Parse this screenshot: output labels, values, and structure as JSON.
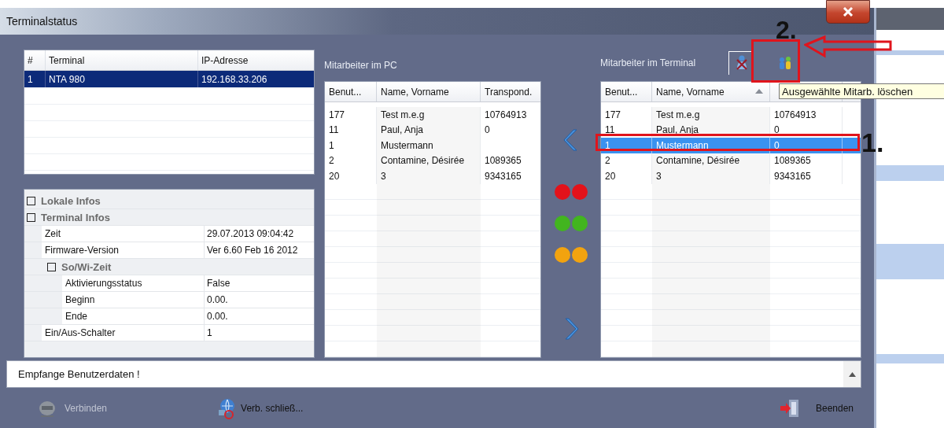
{
  "window": {
    "title": "Terminalstatus"
  },
  "terminals": {
    "columns": [
      "#",
      "Terminal",
      "IP-Adresse"
    ],
    "rows": [
      {
        "cells": [
          "1",
          "NTA 980",
          "192.168.33.206"
        ],
        "selected": true
      }
    ]
  },
  "properties": [
    {
      "kind": "category",
      "label": "Lokale Infos"
    },
    {
      "kind": "category",
      "label": "Terminal Infos",
      "children": [
        {
          "kind": "property",
          "label": "Zeit",
          "value": "29.07.2013 09:04:42"
        },
        {
          "kind": "property",
          "label": "Firmware-Version",
          "value": "Ver 6.60 Feb 16 2012"
        },
        {
          "kind": "category",
          "label": "So/Wi-Zeit",
          "children": [
            {
              "kind": "property",
              "label": "Aktivierungsstatus",
              "value": "False"
            },
            {
              "kind": "property",
              "label": "Beginn",
              "value": " 0.00."
            },
            {
              "kind": "property",
              "label": "Ende",
              "value": " 0.00."
            }
          ]
        },
        {
          "kind": "property",
          "label": "Ein/Aus-Schalter",
          "value": "1"
        }
      ]
    }
  ],
  "pc_employees": {
    "title": "Mitarbeiter im PC",
    "columns": [
      {
        "label": "Benut...",
        "sorted": false
      },
      {
        "label": "Name, Vorname",
        "sorted": false
      },
      {
        "label": "Transpond.",
        "sorted": false
      }
    ],
    "rows": [
      {
        "cells": [
          "177",
          "Test m.e.g",
          "10764913"
        ],
        "selected": false
      },
      {
        "cells": [
          "11",
          "Paul, Anja",
          "0"
        ],
        "selected": false
      },
      {
        "cells": [
          "1",
          "Mustermann"
        ],
        "selected": false
      },
      {
        "cells": [
          "2",
          "Contamine, Désirée",
          "1089365"
        ],
        "selected": false
      },
      {
        "cells": [
          "20",
          "3",
          "9343165"
        ],
        "selected": false
      }
    ]
  },
  "lamps": [
    {
      "color": "#e3121a"
    },
    {
      "color": "#42b51f"
    },
    {
      "color": "#f2a30f"
    }
  ],
  "terminal_employees": {
    "title": "Mitarbeiter im Terminal",
    "columns": [
      {
        "label": "Benut...",
        "sorted": false
      },
      {
        "label": "Name, Vorname",
        "sorted": true
      }
    ],
    "rows": [
      {
        "cells": [
          "177",
          "Test m.e.g",
          "10764913"
        ],
        "selected": false
      },
      {
        "cells": [
          "11",
          "Paul, Anja",
          "0"
        ],
        "selected": false
      },
      {
        "cells": [
          "1",
          "Mustermann",
          "0"
        ],
        "selected": true
      },
      {
        "cells": [
          "2",
          "Contamine, Désirée",
          "1089365"
        ],
        "selected": false
      },
      {
        "cells": [
          "20",
          "3",
          "9343165"
        ],
        "selected": false
      }
    ]
  },
  "tooltip": "Ausgewählte Mitarb. löschen",
  "status": {
    "message": "Empfange Benutzerdaten !"
  },
  "buttons": [
    {
      "kind": "connect",
      "label": "Verbinden",
      "disabled": true
    },
    {
      "kind": "disconnect",
      "label": "Verb. schließ...",
      "disabled": false
    },
    {
      "kind": "exit",
      "label": "Beenden",
      "disabled": false
    }
  ],
  "annotations": [
    {
      "kind": "toolbar",
      "label": "2."
    },
    {
      "kind": "row",
      "label": "1."
    }
  ]
}
